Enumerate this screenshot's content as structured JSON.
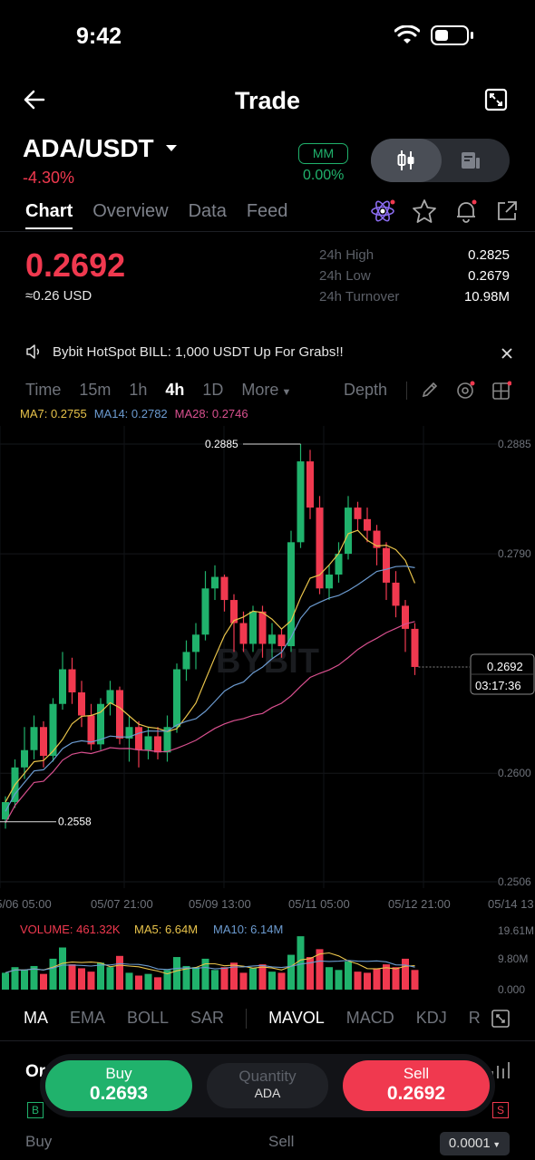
{
  "status": {
    "time": "9:42"
  },
  "nav": {
    "title": "Trade"
  },
  "pair": {
    "symbol": "ADA/USDT",
    "change": "-4.30%",
    "mm_label": "MM",
    "mm_pct": "0.00%"
  },
  "tabs": [
    {
      "label": "Chart",
      "active": true
    },
    {
      "label": "Overview",
      "active": false
    },
    {
      "label": "Data",
      "active": false
    },
    {
      "label": "Feed",
      "active": false
    }
  ],
  "price": {
    "last": "0.2692",
    "usd": "≈0.26 USD"
  },
  "stats": [
    {
      "label": "24h High",
      "value": "0.2825"
    },
    {
      "label": "24h Low",
      "value": "0.2679"
    },
    {
      "label": "24h Turnover",
      "value": "10.98M"
    }
  ],
  "announcement": {
    "text": "Bybit HotSpot BILL: 1,000 USDT Up For Grabs!!"
  },
  "intervals": {
    "items": [
      "Time",
      "15m",
      "1h",
      "4h",
      "1D",
      "More"
    ],
    "selected": "4h",
    "depth": "Depth"
  },
  "ma_legend": {
    "ma7": "MA7: 0.2755",
    "ma14": "MA14: 0.2782",
    "ma28": "MA28: 0.2746",
    "colors": {
      "ma7": "#e8c34a",
      "ma14": "#6c9bd0",
      "ma28": "#d9508f"
    }
  },
  "chart_data": {
    "type": "candlestick",
    "y_ticks": [
      "0.2885",
      "0.2790",
      "0.2600",
      "0.2506"
    ],
    "y_range": [
      0.2506,
      0.2885
    ],
    "x_ticks": [
      "05/06 05:00",
      "05/07 21:00",
      "05/09 13:00",
      "05/11 05:00",
      "05/12 21:00",
      "05/14 13"
    ],
    "high_marker": "0.2885",
    "low_marker": "0.2558",
    "last_price": "0.2692",
    "countdown": "03:17:36",
    "watermark": "BYBIT",
    "candles": [
      [
        0.256,
        0.2575,
        0.2552,
        0.258
      ],
      [
        0.2575,
        0.2605,
        0.257,
        0.2612
      ],
      [
        0.2605,
        0.262,
        0.2595,
        0.264
      ],
      [
        0.262,
        0.264,
        0.2612,
        0.265
      ],
      [
        0.264,
        0.2615,
        0.2605,
        0.2645
      ],
      [
        0.2615,
        0.266,
        0.261,
        0.2665
      ],
      [
        0.266,
        0.269,
        0.2655,
        0.2705
      ],
      [
        0.269,
        0.267,
        0.266,
        0.27
      ],
      [
        0.267,
        0.265,
        0.264,
        0.268
      ],
      [
        0.265,
        0.2625,
        0.262,
        0.266
      ],
      [
        0.2625,
        0.266,
        0.262,
        0.2665
      ],
      [
        0.266,
        0.2672,
        0.265,
        0.268
      ],
      [
        0.2672,
        0.263,
        0.2625,
        0.2675
      ],
      [
        0.263,
        0.264,
        0.261,
        0.265
      ],
      [
        0.264,
        0.262,
        0.2605,
        0.2645
      ],
      [
        0.262,
        0.2632,
        0.2612,
        0.264
      ],
      [
        0.2632,
        0.2618,
        0.2612,
        0.264
      ],
      [
        0.2618,
        0.264,
        0.261,
        0.265
      ],
      [
        0.264,
        0.269,
        0.2635,
        0.2695
      ],
      [
        0.269,
        0.2705,
        0.268,
        0.2715
      ],
      [
        0.2705,
        0.272,
        0.269,
        0.273
      ],
      [
        0.272,
        0.276,
        0.2715,
        0.2775
      ],
      [
        0.276,
        0.277,
        0.275,
        0.278
      ],
      [
        0.277,
        0.275,
        0.274,
        0.2772
      ],
      [
        0.275,
        0.273,
        0.2705,
        0.2755
      ],
      [
        0.273,
        0.2712,
        0.2705,
        0.274
      ],
      [
        0.2712,
        0.274,
        0.2705,
        0.2745
      ],
      [
        0.274,
        0.2712,
        0.27,
        0.2745
      ],
      [
        0.2712,
        0.272,
        0.27,
        0.273
      ],
      [
        0.272,
        0.271,
        0.27,
        0.2725
      ],
      [
        0.271,
        0.28,
        0.2705,
        0.281
      ],
      [
        0.28,
        0.287,
        0.2795,
        0.2885
      ],
      [
        0.287,
        0.283,
        0.282,
        0.288
      ],
      [
        0.283,
        0.276,
        0.2755,
        0.284
      ],
      [
        0.276,
        0.2772,
        0.275,
        0.278
      ],
      [
        0.2772,
        0.279,
        0.2765,
        0.28
      ],
      [
        0.279,
        0.283,
        0.2785,
        0.284
      ],
      [
        0.283,
        0.282,
        0.281,
        0.2835
      ],
      [
        0.282,
        0.281,
        0.28,
        0.283
      ],
      [
        0.281,
        0.2795,
        0.278,
        0.2815
      ],
      [
        0.2795,
        0.2765,
        0.275,
        0.28
      ],
      [
        0.2765,
        0.2745,
        0.2735,
        0.2775
      ],
      [
        0.2745,
        0.2725,
        0.2705,
        0.275
      ],
      [
        0.2725,
        0.2692,
        0.2685,
        0.273
      ]
    ]
  },
  "volume": {
    "legend": {
      "vol": "VOLUME: 461.32K",
      "ma5": "MA5: 6.64M",
      "ma10": "MA10: 6.14M"
    },
    "y_ticks": [
      "19.61M",
      "9.80M",
      "0.000"
    ]
  },
  "indicators": {
    "items": [
      "MA",
      "EMA",
      "BOLL",
      "SAR",
      "MAVOL",
      "MACD",
      "KDJ",
      "R"
    ],
    "selected": [
      "MA",
      "MAVOL"
    ]
  },
  "orderbook": {
    "title": "Or",
    "buy_col": "Buy",
    "sell_col": "Sell",
    "precision": "0.0001"
  },
  "trade": {
    "buy_label": "Buy",
    "buy_price": "0.2693",
    "sell_label": "Sell",
    "sell_price": "0.2692",
    "qty_label": "Quantity",
    "qty_unit": "ADA"
  },
  "colors": {
    "up": "#20b26c",
    "down": "#f0394f",
    "bg": "#000000"
  }
}
